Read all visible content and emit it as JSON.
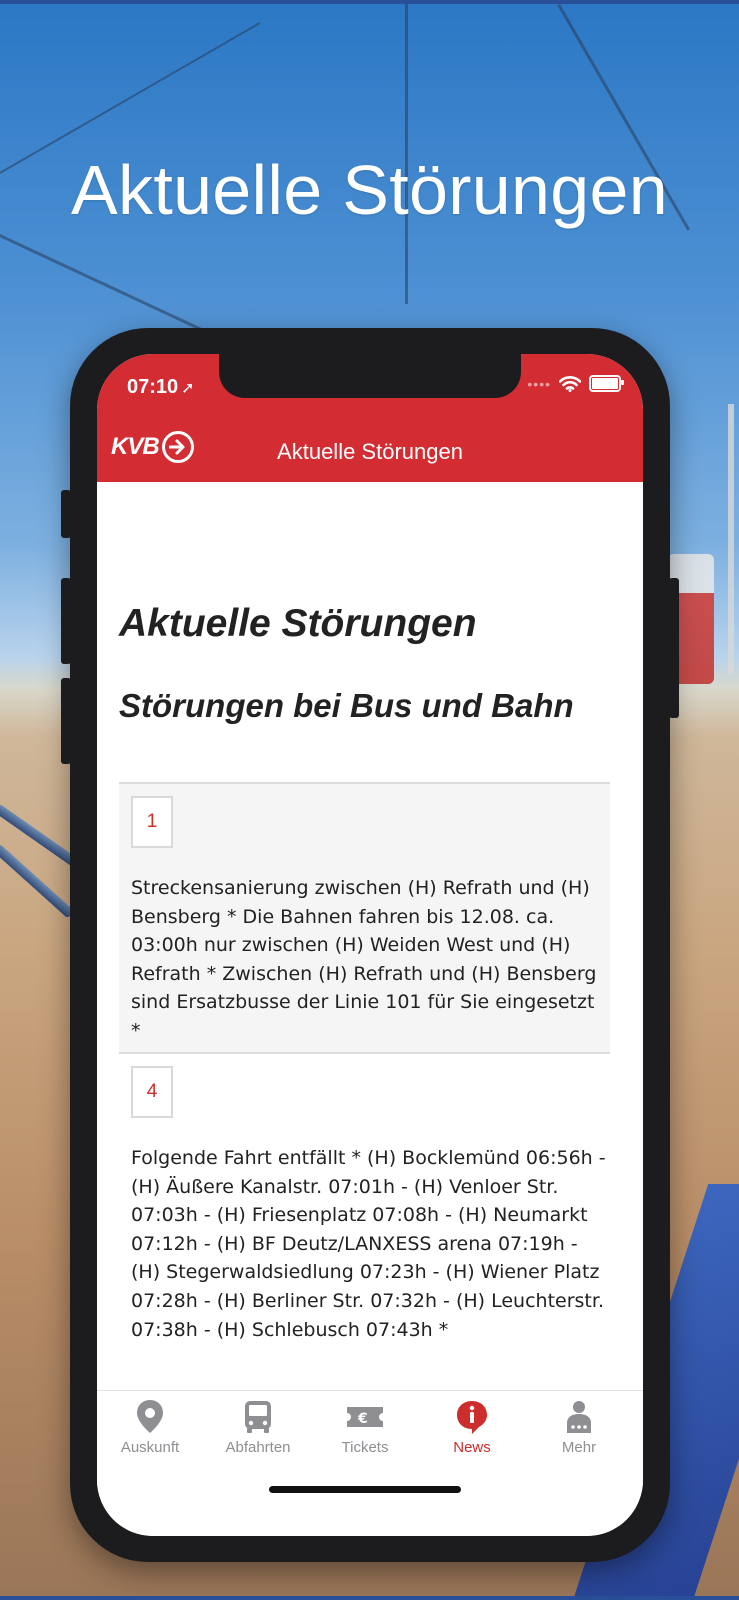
{
  "promo": {
    "title": "Aktuelle Störungen"
  },
  "status_bar": {
    "time": "07:10",
    "location_arrow": "➚"
  },
  "app_header": {
    "logo_text": "KVB",
    "title": "Aktuelle Störungen"
  },
  "content": {
    "heading": "Aktuelle Störungen",
    "subheading": "Störungen bei Bus und Bahn",
    "notices": [
      {
        "line": "1",
        "text": "Streckensanierung zwischen (H) Refrath und (H) Bensberg * Die Bahnen fahren bis 12.08. ca. 03:00h nur zwischen (H) Weiden West und (H) Refrath * Zwischen (H) Refrath und (H) Bensberg sind Ersatzbusse der Linie 101 für Sie eingesetzt *"
      },
      {
        "line": "4",
        "text": "Folgende Fahrt entfällt * (H) Bocklemünd 06:56h - (H) Äußere Kanalstr. 07:01h - (H) Venloer Str. 07:03h - (H) Friesenplatz 07:08h - (H) Neumarkt 07:12h - (H) BF Deutz/LANXESS arena 07:19h - (H) Stegerwaldsiedlung 07:23h - (H) Wiener Platz 07:28h - (H) Berliner Str. 07:32h - (H) Leuchterstr. 07:38h - (H) Schlebusch 07:43h *"
      }
    ]
  },
  "tabbar": {
    "tabs": [
      {
        "label": "Auskunft",
        "icon": "location-pin-icon"
      },
      {
        "label": "Abfahrten",
        "icon": "bus-icon"
      },
      {
        "label": "Tickets",
        "icon": "ticket-icon"
      },
      {
        "label": "News",
        "icon": "info-bubble-icon",
        "active": true
      },
      {
        "label": "Mehr",
        "icon": "person-more-icon"
      }
    ]
  },
  "colors": {
    "brand_red": "#d32d33",
    "active_tab": "#cc2e2e",
    "inactive_tab": "#8e8e93"
  }
}
